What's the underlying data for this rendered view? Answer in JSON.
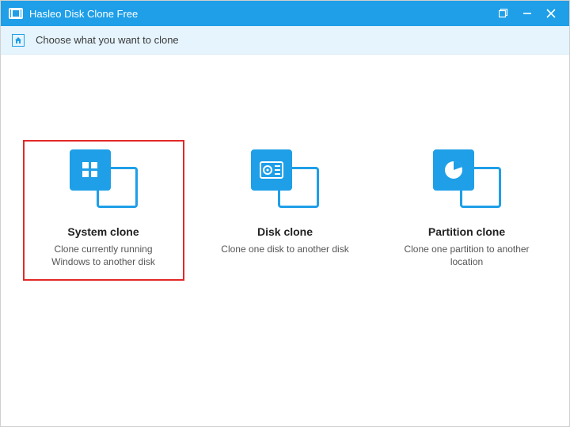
{
  "titlebar": {
    "app_title": "Hasleo Disk Clone Free"
  },
  "subheader": {
    "text": "Choose what you want to clone"
  },
  "options": {
    "system": {
      "title": "System clone",
      "desc": "Clone currently running Windows to another disk"
    },
    "disk": {
      "title": "Disk clone",
      "desc": "Clone one disk to another disk"
    },
    "partition": {
      "title": "Partition clone",
      "desc": "Clone one partition to another location"
    }
  }
}
